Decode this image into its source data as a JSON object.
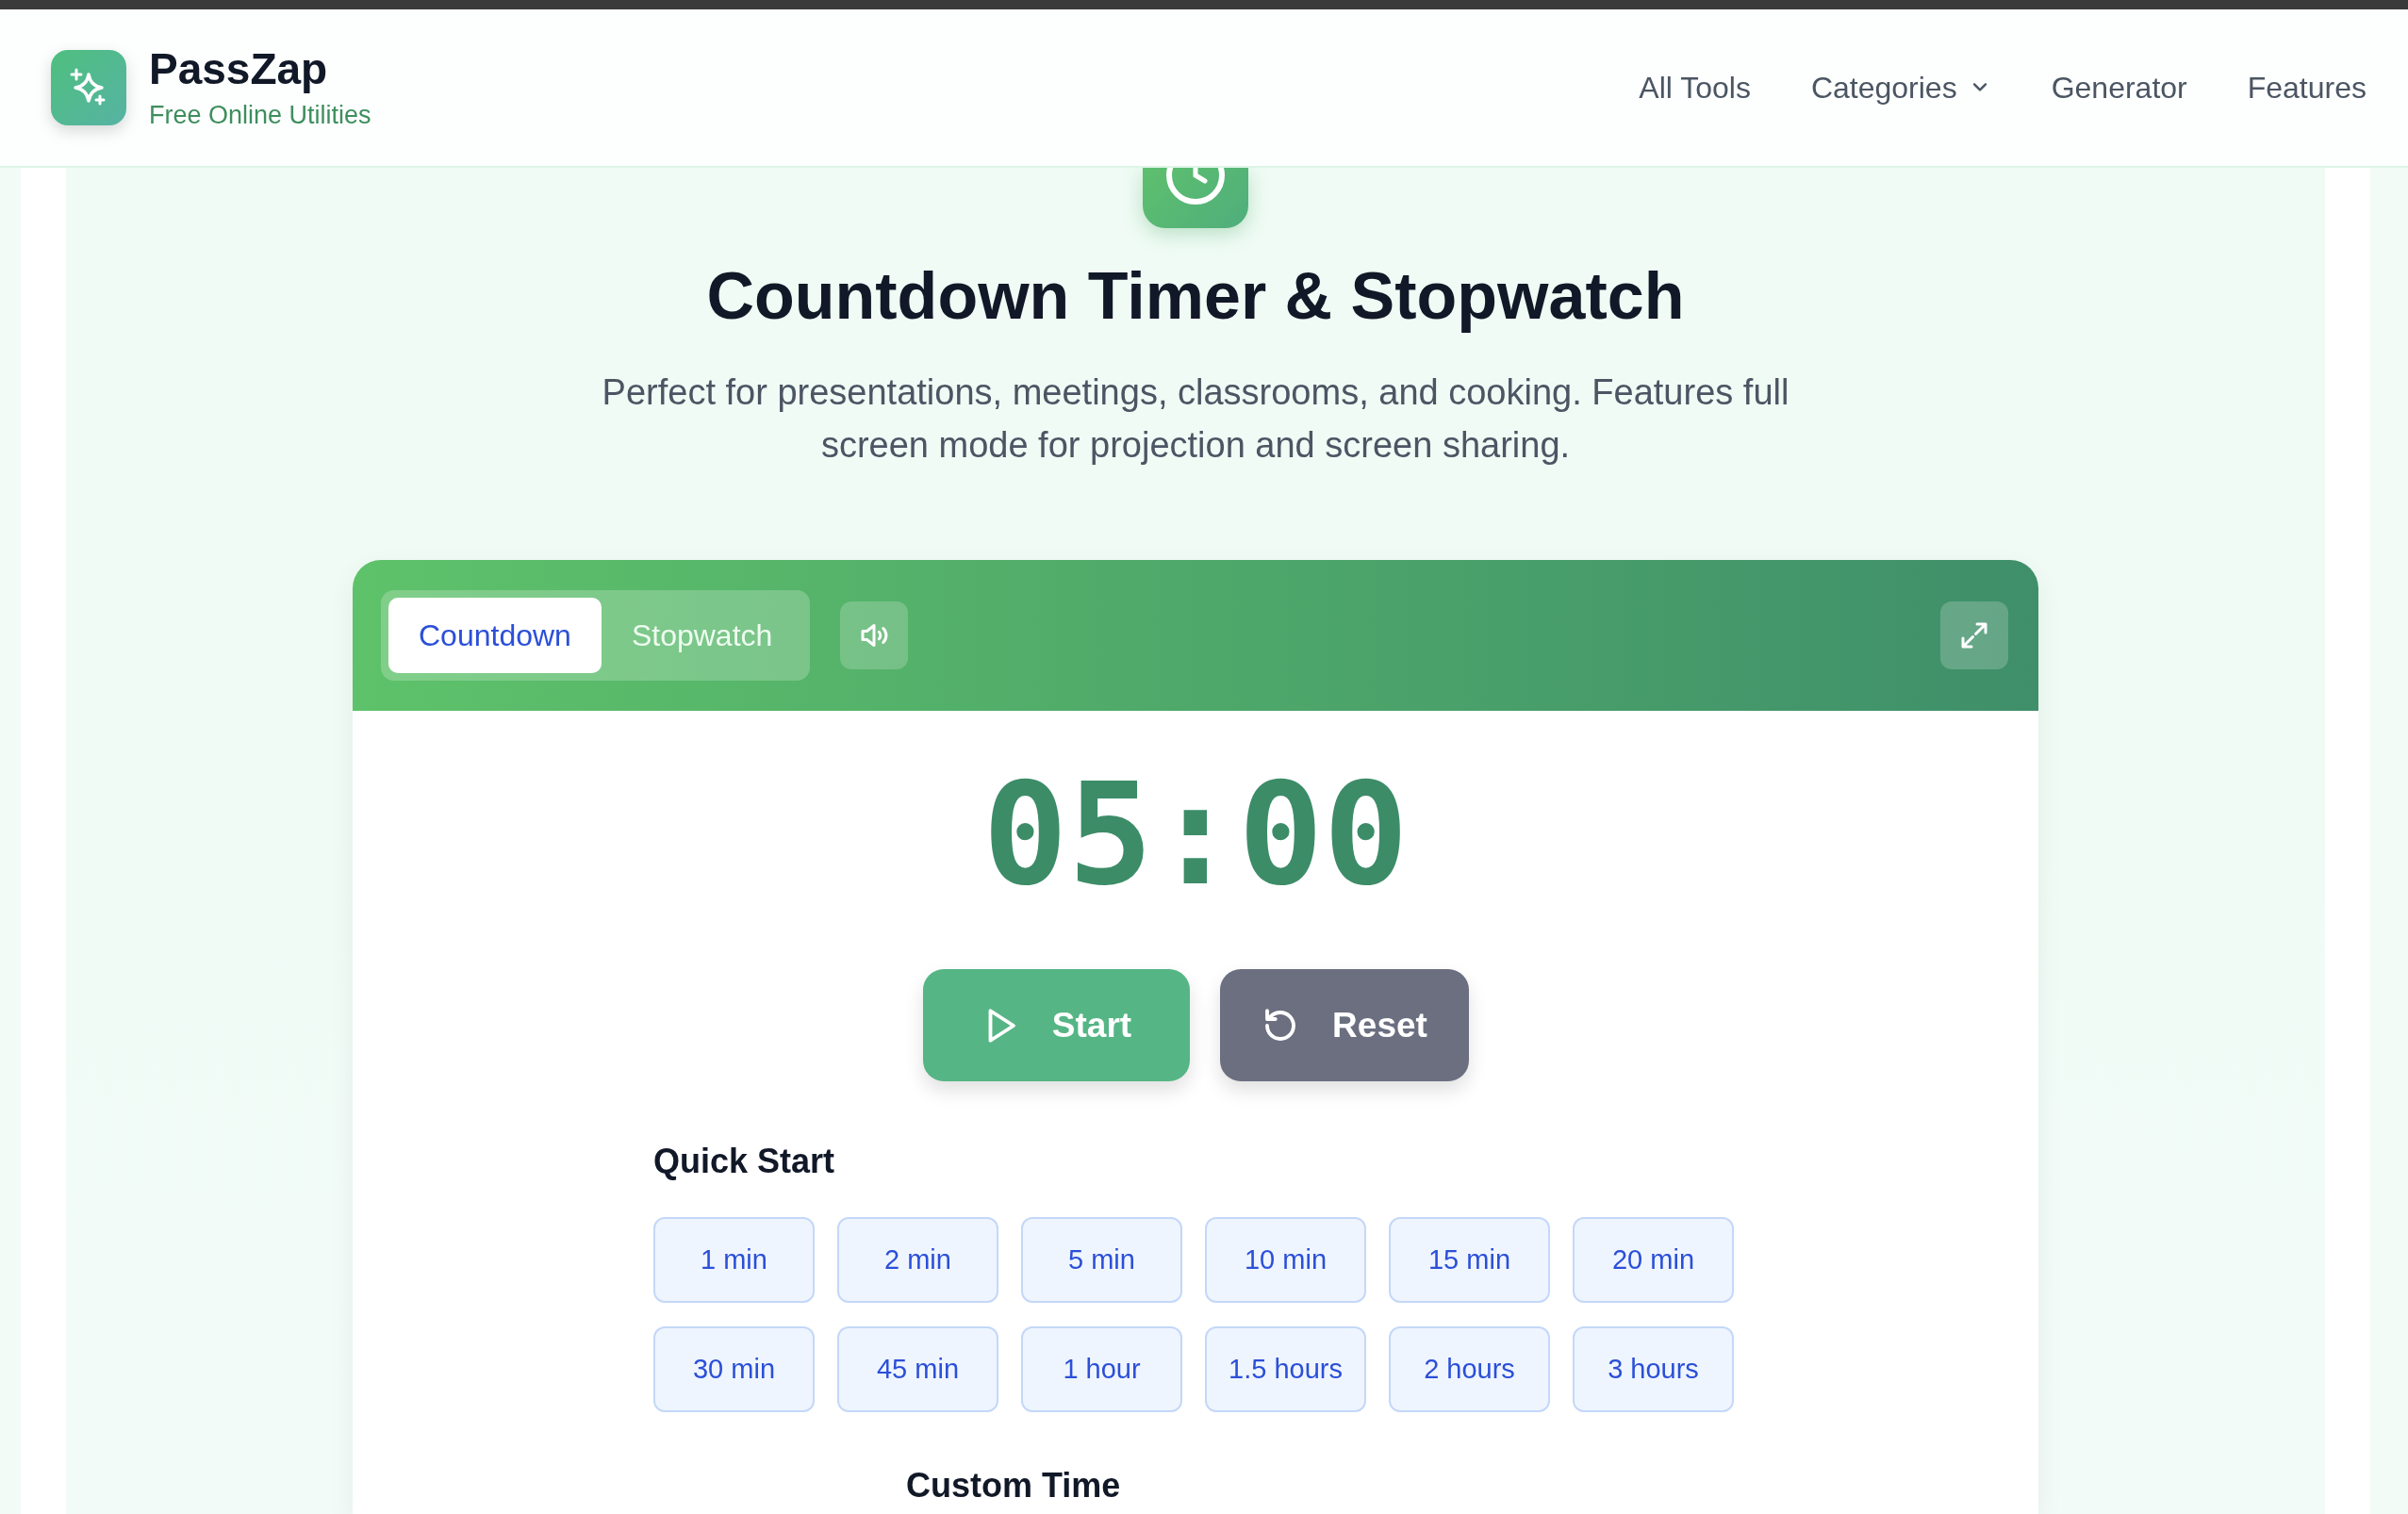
{
  "brand": {
    "name": "PassZap",
    "tagline": "Free Online Utilities"
  },
  "nav": [
    {
      "label": "All Tools",
      "kind": "link"
    },
    {
      "label": "Categories",
      "kind": "dropdown"
    },
    {
      "label": "Generator",
      "kind": "link"
    },
    {
      "label": "Features",
      "kind": "link"
    }
  ],
  "hero": {
    "title": "Countdown Timer & Stopwatch",
    "subtitle": "Perfect for presentations, meetings, classrooms, and cooking. Features full screen mode for projection and screen sharing."
  },
  "timer": {
    "tabs": [
      {
        "label": "Countdown",
        "selected": true
      },
      {
        "label": "Stopwatch",
        "selected": false
      }
    ],
    "display": "05:00",
    "buttons": [
      {
        "label": "Start",
        "kind": "start"
      },
      {
        "label": "Reset",
        "kind": "reset"
      }
    ],
    "quick_start": {
      "title": "Quick Start",
      "presets": [
        "1 min",
        "2 min",
        "5 min",
        "10 min",
        "15 min",
        "20 min",
        "30 min",
        "45 min",
        "1 hour",
        "1.5 hours",
        "2 hours",
        "3 hours"
      ]
    },
    "custom_time": {
      "title": "Custom Time"
    }
  }
}
